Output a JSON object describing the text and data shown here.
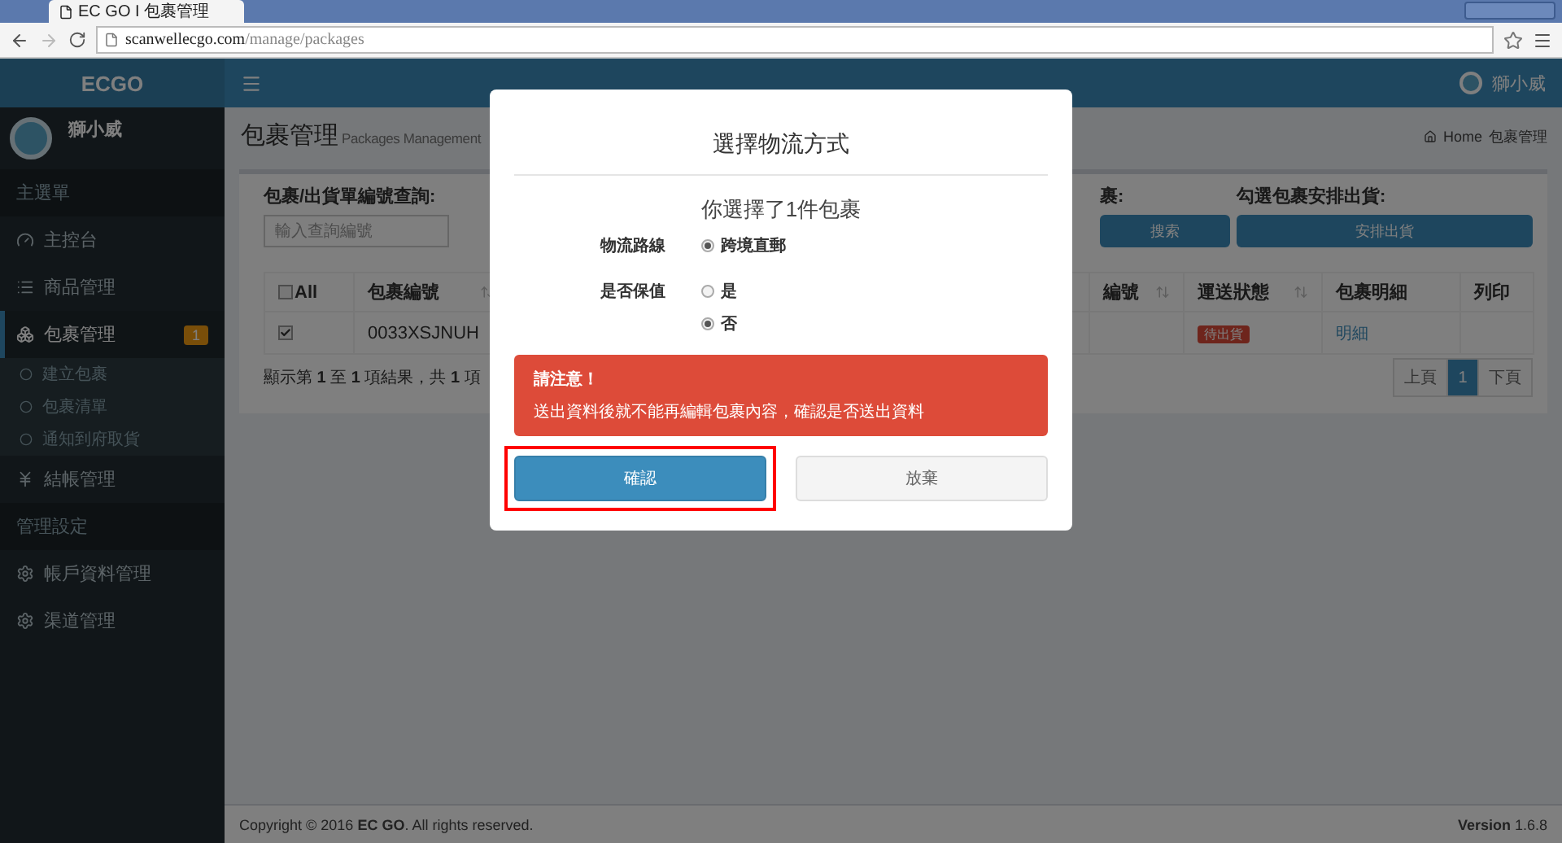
{
  "browser": {
    "tab_title": "EC GO I 包裹管理",
    "url_host": "scanwellecgo.com",
    "url_path": "/manage/packages"
  },
  "header": {
    "brand": "ECGO",
    "user_name": "獅小威"
  },
  "sidebar": {
    "user_name": "獅小威",
    "items": [
      {
        "kind": "header",
        "label": "主選單"
      },
      {
        "kind": "item",
        "label": "主控台",
        "selected": false
      },
      {
        "kind": "item",
        "label": "商品管理",
        "selected": false
      },
      {
        "kind": "item",
        "label": "包裹管理",
        "selected": true,
        "badge": "1",
        "expanded": true,
        "children": [
          {
            "label": "建立包裹"
          },
          {
            "label": "包裹清單"
          },
          {
            "label": "通知到府取貨"
          }
        ]
      },
      {
        "kind": "item",
        "label": "結帳管理",
        "selected": false
      },
      {
        "kind": "header",
        "label": "管理設定"
      },
      {
        "kind": "item",
        "label": "帳戶資料管理",
        "selected": false
      },
      {
        "kind": "item",
        "label": "渠道管理",
        "selected": false
      }
    ]
  },
  "page": {
    "title": "包裹管理",
    "subtitle": "Packages Management",
    "breadcrumb": [
      "Home",
      "包裹管理"
    ]
  },
  "filters": {
    "search_label": "包裹/出貨單編號查詢:",
    "search_placeholder": "輸入查詢編號",
    "label_3": "裹:",
    "button_3": "搜索",
    "ship_label": "勾選包裹安排出貨:",
    "ship_button": "安排出貨"
  },
  "table": {
    "columns": [
      {
        "label": "All",
        "kind": "check",
        "sortable": false
      },
      {
        "label": "包裹編號",
        "kind": "text",
        "sortable": true
      },
      {
        "kind": "hidden"
      },
      {
        "label": "編號",
        "kind": "text",
        "sortable": true
      },
      {
        "label": "運送狀態",
        "kind": "text",
        "sortable": true
      },
      {
        "label": "包裹明細",
        "kind": "text",
        "sortable": false
      },
      {
        "label": "列印",
        "kind": "text",
        "sortable": false
      }
    ],
    "all_checked": false,
    "rows": [
      {
        "checked": true,
        "package_no": "0033XSJNUH",
        "status": "待出貨",
        "detail_link": "明細"
      }
    ],
    "info": "顯示第 **1** 至 **1** 項結果，共 **1** 項",
    "pagination": [
      {
        "label": "上頁",
        "selected": false
      },
      {
        "label": "1",
        "selected": true
      },
      {
        "label": "下頁",
        "selected": false
      }
    ]
  },
  "modal": {
    "title": "選擇物流方式",
    "summary": "你選擇了1件包裹",
    "fields": [
      {
        "label": "物流路線",
        "options": [
          {
            "label": "跨境直郵",
            "selected": true
          }
        ]
      },
      {
        "label": "是否保值",
        "options": [
          {
            "label": "是",
            "selected": false
          },
          {
            "label": "否",
            "selected": true
          }
        ]
      }
    ],
    "alert": {
      "title": "請注意！",
      "message": "送出資料後就不能再編輯包裹內容，確認是否送出資料"
    },
    "buttons": [
      {
        "label": "確認",
        "kind": "primary",
        "highlighted": true
      },
      {
        "label": "放棄",
        "kind": "default",
        "highlighted": false
      }
    ]
  },
  "footer": {
    "copyright": "Copyright © 2016 **EC GO**. All rights reserved.",
    "version_label": "Version",
    "version": "1.6.8"
  }
}
